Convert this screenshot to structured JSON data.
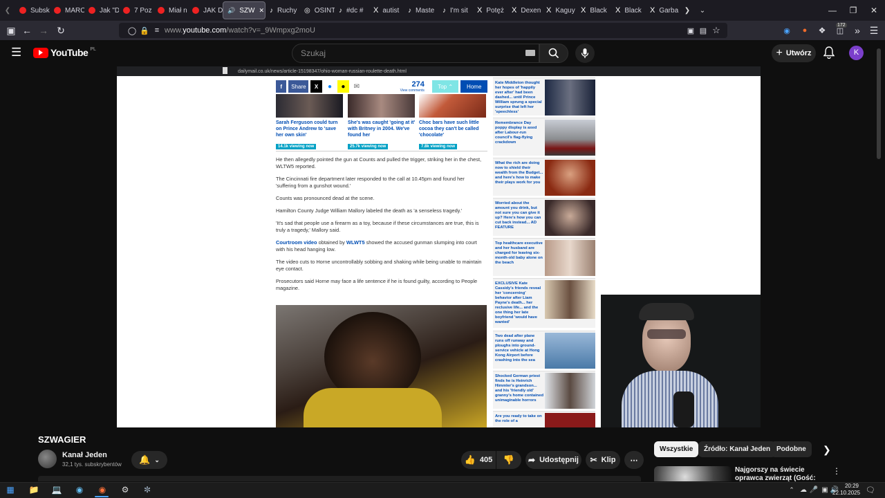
{
  "browser": {
    "tabs": [
      {
        "label": "Subsk",
        "icon": "youtube-icon"
      },
      {
        "label": "MARC",
        "icon": "youtube-icon"
      },
      {
        "label": "Jak \"D",
        "icon": "youtube-icon"
      },
      {
        "label": "7 Poz",
        "icon": "youtube-icon"
      },
      {
        "label": "Miał n",
        "icon": "youtube-icon"
      },
      {
        "label": "JAK D",
        "icon": "youtube-icon"
      },
      {
        "label": "SZW",
        "icon": "youtube-icon",
        "active": true
      },
      {
        "label": "Ruchy",
        "icon": "tiktok-icon"
      },
      {
        "label": "OSINT",
        "icon": "globe-icon"
      },
      {
        "label": "#dc #",
        "icon": "tiktok-icon"
      },
      {
        "label": "autist",
        "icon": "x-icon"
      },
      {
        "label": "Maste",
        "icon": "tiktok-icon"
      },
      {
        "label": "I'm sit",
        "icon": "tiktok-icon"
      },
      {
        "label": "Potęż",
        "icon": "x-icon"
      },
      {
        "label": "Dexen",
        "icon": "x-icon"
      },
      {
        "label": "Kaguy",
        "icon": "x-icon"
      },
      {
        "label": "Black",
        "icon": "x-icon"
      },
      {
        "label": "Black",
        "icon": "x-icon"
      },
      {
        "label": "Garba",
        "icon": "x-icon"
      }
    ],
    "url_prefix": "www.",
    "url_domain": "youtube.com",
    "url_path": "/watch?v=_9Wmpxg2moU",
    "extensions_badge": "172"
  },
  "youtube": {
    "logo_text": "YouTube",
    "logo_region": "PL",
    "search_placeholder": "Szukaj",
    "create_label": "Utwórz",
    "avatar_letter": "K"
  },
  "video_content": {
    "inner_url": "dailymail.co.uk/news/article-15198347/ohio-woman-russian-roulette-death.html",
    "share_label": "Share",
    "comments_count": "274",
    "comments_label": "View comments",
    "top_label": "Top",
    "home_label": "Home",
    "top_stories": [
      {
        "headline": "Sarah Ferguson could turn on Prince Andrew to 'save her own skin'",
        "views": "14.1k viewing now"
      },
      {
        "headline": "She's was caught 'going at it' with Britney in 2004. We've found her",
        "views": "25.7k viewing now"
      },
      {
        "headline": "Choc bars have such little cocoa they can't be called 'chocolate'",
        "views": "7.8k viewing now"
      }
    ],
    "paragraphs": [
      "He then allegedly pointed the gun at Counts and pulled the trigger, striking her in the chest, WLTW5 reported.",
      "The Cincinnati fire department later responded to the call at 10.45pm and found her 'suffering from a gunshot wound.'",
      "Counts was pronounced dead at the scene.",
      "Hamilton County Judge William Mallory labeled the death as 'a senseless tragedy.'",
      "'It's sad that people use a firearm as a toy, because if these circumstances are true, this is truly a tragedy,' Mallory said."
    ],
    "para_court_link1": "Courtroom video",
    "para_court_mid": " obtained by ",
    "para_court_link2": "WLWT5",
    "para_court_rest": " showed the accused gunman slumping into court with his head hanging low.",
    "paragraphs2": [
      "The video cuts to Horne uncontrollably sobbing and shaking while being unable to maintain eye contact.",
      "Prosecutors said Horne may face a life sentence if he is found guilty, according to People magazine."
    ],
    "sidebar": [
      "Kate Middleton thought her hopes of 'happily ever after' had been dashed... until Prince William sprung a special surprise that left her 'speechless'",
      "Remembrance Day poppy display is axed after Labour-run council's flag-flying crackdown",
      "What the rich are doing now to shield their wealth from the Budget... and here's how to make their plays work for you",
      "Worried about the amount you drink, but not sure you can give it up? Here's how you can cut back instead... AD FEATURE",
      "Top healthcare executive and her husband are charged for leaving six-month-old baby alone on the beach",
      "EXCLUSIVE Kate Cassidy's friends reveal her 'concerning' behavior after Liam Payne's death... her reclusive life... and the one thing her late boyfriend 'would have wanted'",
      "Two dead after plane runs off runway and ploughs into ground-service vehicle at Hong Kong Airport before crashing into the sea",
      "Shocked German priest finds he is Heinrich Himmler's grandson... and his 'friendly old' granny's home contained unimaginable horrors",
      "Are you ready to take on the role of a"
    ]
  },
  "video_info": {
    "title": "SZWAGIER",
    "channel_name": "Kanał Jeden",
    "subscribers": "32,1 tys. subskrybentów",
    "likes": "405",
    "share_label": "Udostępnij",
    "clip_label": "Klip"
  },
  "related_chips": [
    "Wszystkie",
    "Źródło: Kanał Jeden",
    "Podobne"
  ],
  "related_video_title": "Najgorszy na świecie oprawca zwierząt (Gość: Dama Kier)",
  "taskbar": {
    "time": "20:29",
    "date": "22.10.2025"
  }
}
